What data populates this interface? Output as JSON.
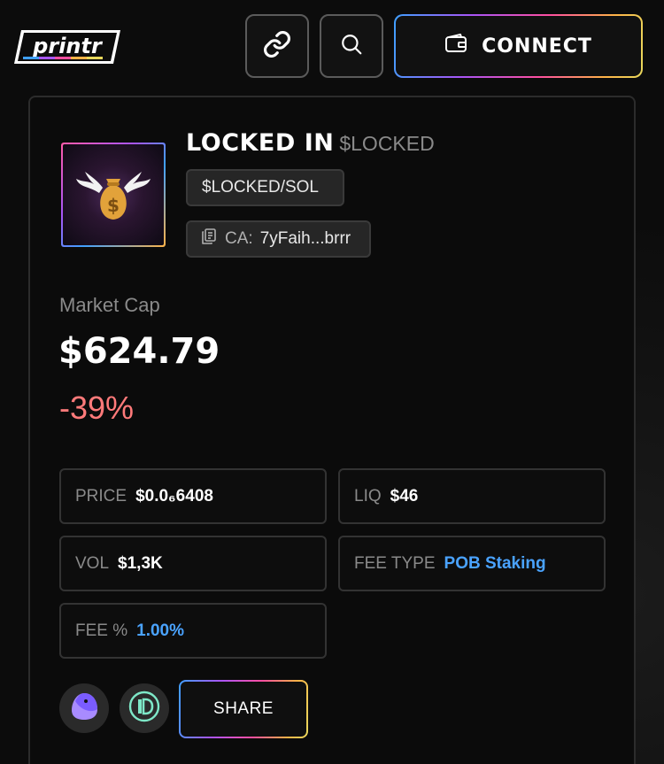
{
  "header": {
    "logo_text": "printr",
    "connect_label": "CONNECT"
  },
  "token": {
    "name": "LOCKED IN",
    "ticker": "$LOCKED",
    "pair": "$LOCKED/SOL",
    "ca_label": "CA:",
    "ca_value": "7yFaih...brrr"
  },
  "market": {
    "label": "Market Cap",
    "value": "$624.79",
    "change": "-39%"
  },
  "stats": {
    "price_label": "PRICE",
    "price_value": "$0.0₆6408",
    "liq_label": "LIQ",
    "liq_value": "$46",
    "vol_label": "VOL",
    "vol_value": "$1,3K",
    "fee_type_label": "FEE TYPE",
    "fee_type_value": "POB Staking",
    "fee_pct_label": "FEE %",
    "fee_pct_value": "1.00%"
  },
  "actions": {
    "share_label": "SHARE"
  },
  "colors": {
    "negative": "#ff7a7a",
    "accent_blue": "#4aa3ff"
  }
}
